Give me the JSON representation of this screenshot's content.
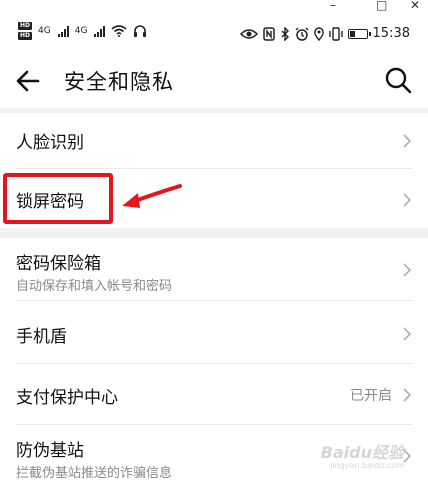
{
  "window": {
    "minimize": "–",
    "maximize": "□",
    "close": "✕"
  },
  "status_bar": {
    "hd1": "HD",
    "hd2": "HD",
    "net1": "4G",
    "net2": "4G",
    "time": "15:38",
    "battery_level": 0.35,
    "icons": [
      "eye-icon",
      "nfc-icon",
      "bluetooth-icon",
      "alarm-icon",
      "location-icon",
      "vibrate-icon",
      "battery-icon"
    ]
  },
  "app_bar": {
    "title": "安全和隐私"
  },
  "list": {
    "face": {
      "label": "人脸识别"
    },
    "lock": {
      "label": "锁屏密码"
    },
    "vault": {
      "label": "密码保险箱",
      "sub": "自动保存和填入帐号和密码"
    },
    "shield": {
      "label": "手机盾"
    },
    "pay": {
      "label": "支付保护中心",
      "value": "已开启"
    },
    "fake_station": {
      "label": "防伪基站",
      "sub": "拦截伪基站推送的诈骗信息"
    }
  },
  "watermark": {
    "main": "Baidu经验",
    "sub": "jingyan.baidu.com"
  },
  "colors": {
    "highlight": "#e5161b",
    "separator": "#f2f2f2",
    "secondary_text": "#8a8a8a"
  }
}
